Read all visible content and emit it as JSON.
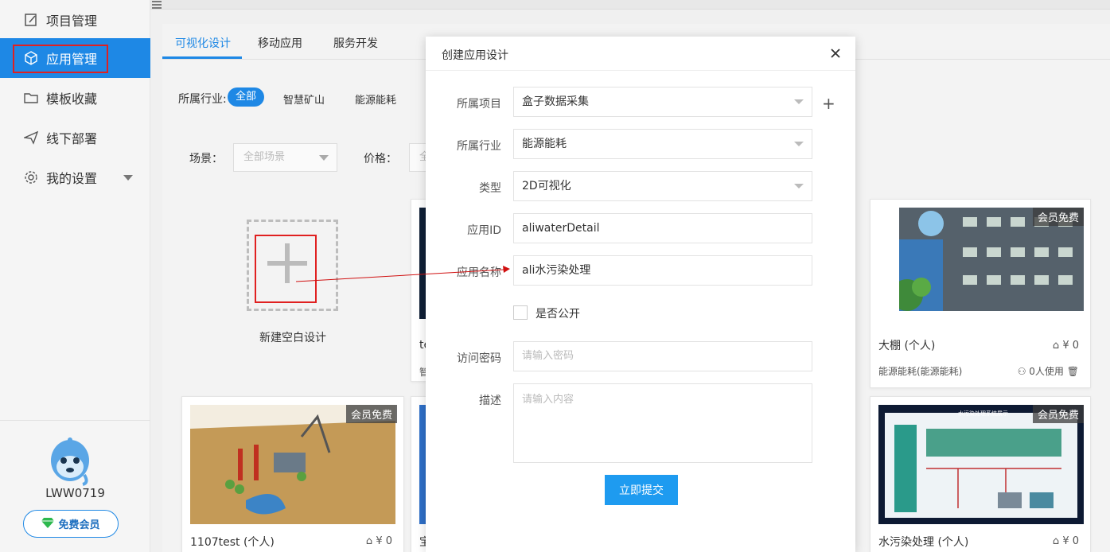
{
  "sidebar": {
    "items": [
      {
        "label": "项目管理",
        "icon": "edit-icon",
        "active": false
      },
      {
        "label": "应用管理",
        "icon": "cube-icon",
        "active": true
      },
      {
        "label": "模板收藏",
        "icon": "folder-icon",
        "active": false
      },
      {
        "label": "线下部署",
        "icon": "send-icon",
        "active": false
      },
      {
        "label": "我的设置",
        "icon": "gear-icon",
        "active": false,
        "expandable": true
      }
    ],
    "username": "LWW0719",
    "vip_label": "免费会员"
  },
  "tabs": [
    {
      "label": "可视化设计",
      "active": true
    },
    {
      "label": "移动应用",
      "active": false
    },
    {
      "label": "服务开发",
      "active": false
    }
  ],
  "filters": {
    "industry_label": "所属行业:",
    "industries": [
      "全部",
      "智慧矿山",
      "能源能耗"
    ],
    "scene_label": "场景：",
    "scene_value": "全部场景",
    "price_label": "价格：",
    "price_value": "全"
  },
  "new_design_label": "新建空白设计",
  "cards": [
    {
      "title": "te",
      "sub": "智"
    },
    {
      "title": "大棚 (个人)",
      "badge": "会员免费",
      "price": "¥ 0",
      "sub": "能源能耗(能源能耗)",
      "users": "0人使用"
    },
    {
      "title": "1107test (个人)",
      "badge": "会员免费",
      "price": "¥ 0"
    },
    {
      "title": "宝"
    },
    {
      "title": "水污染处理 (个人)",
      "badge": "会员免费",
      "price": "¥ 0",
      "thumb_caption": "水污染处理系统展示"
    }
  ],
  "modal": {
    "title": "创建应用设计",
    "fields": {
      "project": {
        "label": "所属项目",
        "value": "盒子数据采集"
      },
      "industry": {
        "label": "所属行业",
        "value": "能源能耗"
      },
      "type": {
        "label": "类型",
        "value": "2D可视化"
      },
      "app_id": {
        "label": "应用ID",
        "value": "aliwaterDetail"
      },
      "app_name": {
        "label": "应用名称",
        "value": "ali水污染处理"
      },
      "public": {
        "label": "是否公开",
        "checked": false
      },
      "password": {
        "label": "访问密码",
        "placeholder": "请输入密码"
      },
      "description": {
        "label": "描述",
        "placeholder": "请输入内容"
      }
    },
    "submit_label": "立即提交"
  },
  "colors": {
    "accent": "#1e88e5",
    "highlight": "#e02020",
    "submit": "#1e9bf0"
  }
}
